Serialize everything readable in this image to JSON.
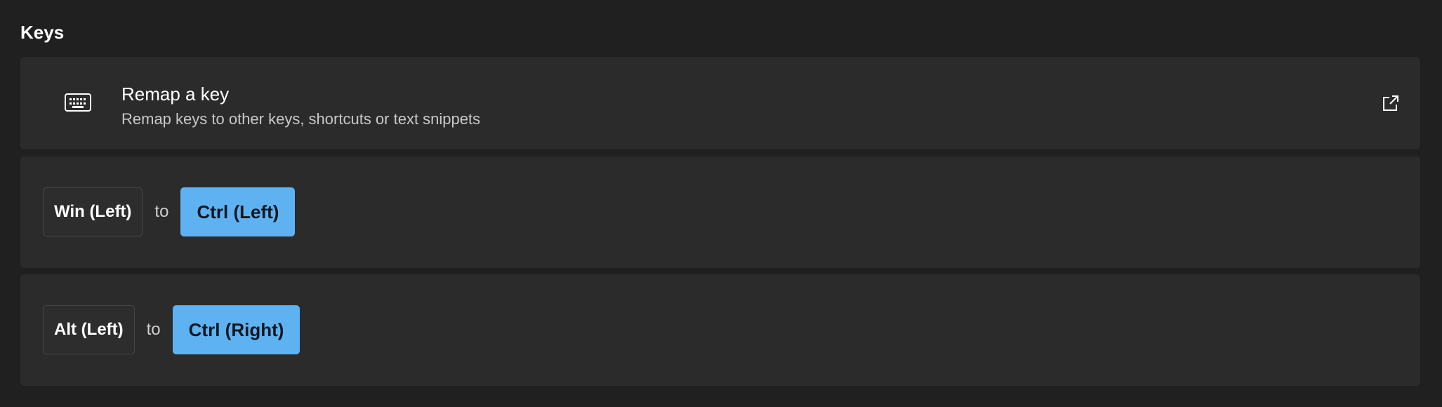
{
  "section": {
    "title": "Keys"
  },
  "remap_card": {
    "icon": "keyboard-icon",
    "title": "Remap a key",
    "description": "Remap keys to other keys, shortcuts or text snippets",
    "action_icon": "open-external-icon"
  },
  "mappings": [
    {
      "from": "Win (Left)",
      "connector": "to",
      "to": "Ctrl (Left)"
    },
    {
      "from": "Alt (Left)",
      "connector": "to",
      "to": "Ctrl (Right)"
    }
  ],
  "colors": {
    "background": "#202020",
    "card": "#2b2b2b",
    "accent": "#5fb2f2",
    "source_key_border": "#464646"
  }
}
